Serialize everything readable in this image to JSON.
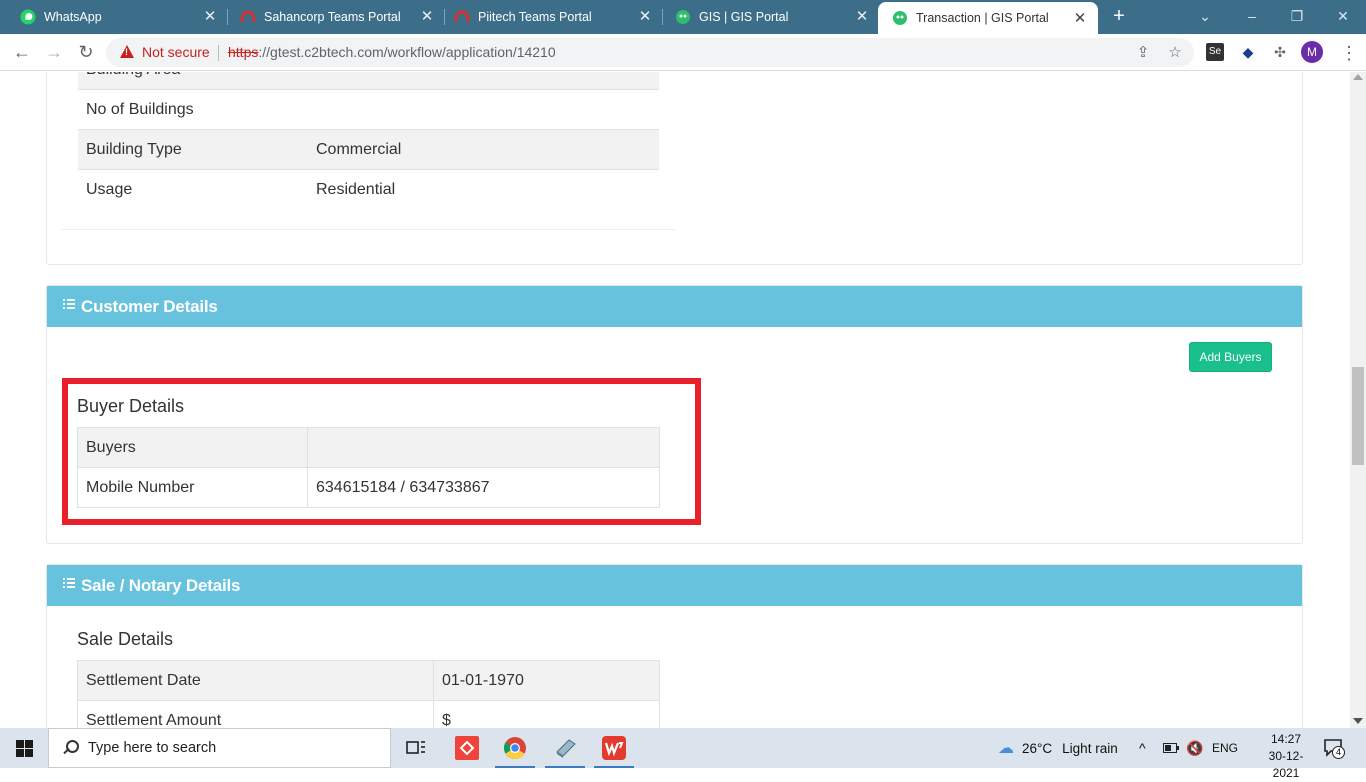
{
  "browser": {
    "tabs": [
      {
        "title": "WhatsApp",
        "icon": "whatsapp-icon",
        "active": false
      },
      {
        "title": "Sahancorp Teams Portal",
        "icon": "teams-portal-icon",
        "active": false
      },
      {
        "title": "Piitech Teams Portal",
        "icon": "teams-portal-icon",
        "active": false
      },
      {
        "title": "GIS | GIS Portal",
        "icon": "gis-portal-icon",
        "active": false
      },
      {
        "title": "Transaction | GIS Portal",
        "icon": "gis-portal-icon",
        "active": true
      }
    ],
    "security_label": "Not secure",
    "url_scheme": "https",
    "url_rest": "://gtest.c2btech.com/workflow/application/14210",
    "profile_initial": "M"
  },
  "property_table": {
    "rows": [
      {
        "label": "Building Area",
        "value": ""
      },
      {
        "label": "No of Buildings",
        "value": ""
      },
      {
        "label": "Building Type",
        "value": "Commercial"
      },
      {
        "label": "Usage",
        "value": "Residential"
      }
    ]
  },
  "customer": {
    "header": "Customer Details",
    "add_button": "Add Buyers",
    "buyer_title": "Buyer Details",
    "rows": [
      {
        "label": "Buyers",
        "value": ""
      },
      {
        "label": "Mobile Number",
        "value": "634615184 / 634733867"
      }
    ]
  },
  "sale": {
    "header": "Sale / Notary Details",
    "title": "Sale Details",
    "rows": [
      {
        "label": "Settlement Date",
        "value": "01-01-1970"
      },
      {
        "label": "Settlement Amount",
        "value": "$"
      }
    ]
  },
  "taskbar": {
    "search_placeholder": "Type here to search",
    "weather_temp": "26°C",
    "weather_desc": "Light rain",
    "language": "ENG",
    "time": "14:27",
    "date": "30-12-2021",
    "notification_count": "4"
  },
  "colors": {
    "tabstrip": "#3c6e8a",
    "panel_header": "#67c2dd",
    "add_button": "#19c08b",
    "highlight": "#e8202a",
    "not_secure": "#c5221f"
  }
}
